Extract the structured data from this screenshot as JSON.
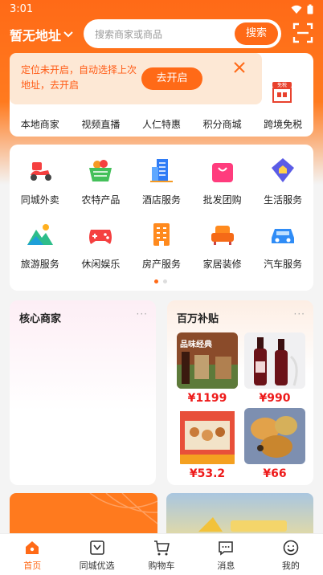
{
  "status_bar": {
    "time": "3:01"
  },
  "header": {
    "location": "暂无地址",
    "search_placeholder": "搜索商家或商品",
    "search_button": "搜索"
  },
  "location_banner": {
    "message": "定位未开启，自动选择上次地址，去开启",
    "open_button": "去开启"
  },
  "quick_nav": {
    "items": [
      "本地商家",
      "视频直播",
      "人仁特惠",
      "积分商城",
      "跨境免税"
    ],
    "duty_free_badge": "免税"
  },
  "services": {
    "items": [
      "同城外卖",
      "农特产品",
      "酒店服务",
      "批发团购",
      "生活服务",
      "旅游服务",
      "休闲娱乐",
      "房产服务",
      "家居装修",
      "汽车服务"
    ]
  },
  "core_merchants": {
    "title": "核心商家",
    "more": "···"
  },
  "million_subsidy": {
    "title": "百万补贴",
    "more": "···",
    "products": [
      {
        "price": "¥1199",
        "caption": "品味经典"
      },
      {
        "price": "¥990"
      },
      {
        "price": "¥53.2"
      },
      {
        "price": "¥66"
      }
    ]
  },
  "tab_bar": {
    "items": [
      "首页",
      "同城优选",
      "购物车",
      "消息",
      "我的"
    ],
    "active": "首页"
  },
  "colors": {
    "accent": "#ff6a17",
    "price": "#ee1a1a"
  }
}
